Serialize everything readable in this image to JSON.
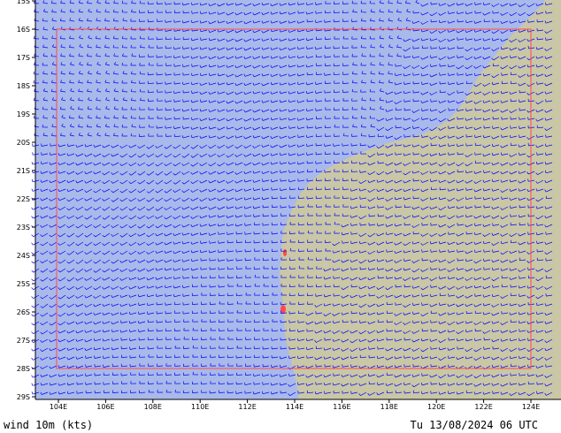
{
  "map": {
    "lat_labels": [
      "15S",
      "16S",
      "17S",
      "18S",
      "19S",
      "20S",
      "21S",
      "22S",
      "23S",
      "24S",
      "25S",
      "26S",
      "27S",
      "28S",
      "29S"
    ],
    "lon_labels": [
      "104E",
      "106E",
      "108E",
      "110E",
      "112E",
      "114E",
      "116E",
      "118E",
      "120E",
      "122E",
      "124E"
    ],
    "colors": {
      "ocean": "#a9b9ea",
      "land": "#c9c7a5",
      "barbs": "#0000ff",
      "domain_box": "#ff4a4a",
      "axis_text": "#000000"
    }
  },
  "footer": {
    "left_label": "wind 10m (kts)",
    "right_label": "Tu 13/08/2024 06 UTC"
  }
}
